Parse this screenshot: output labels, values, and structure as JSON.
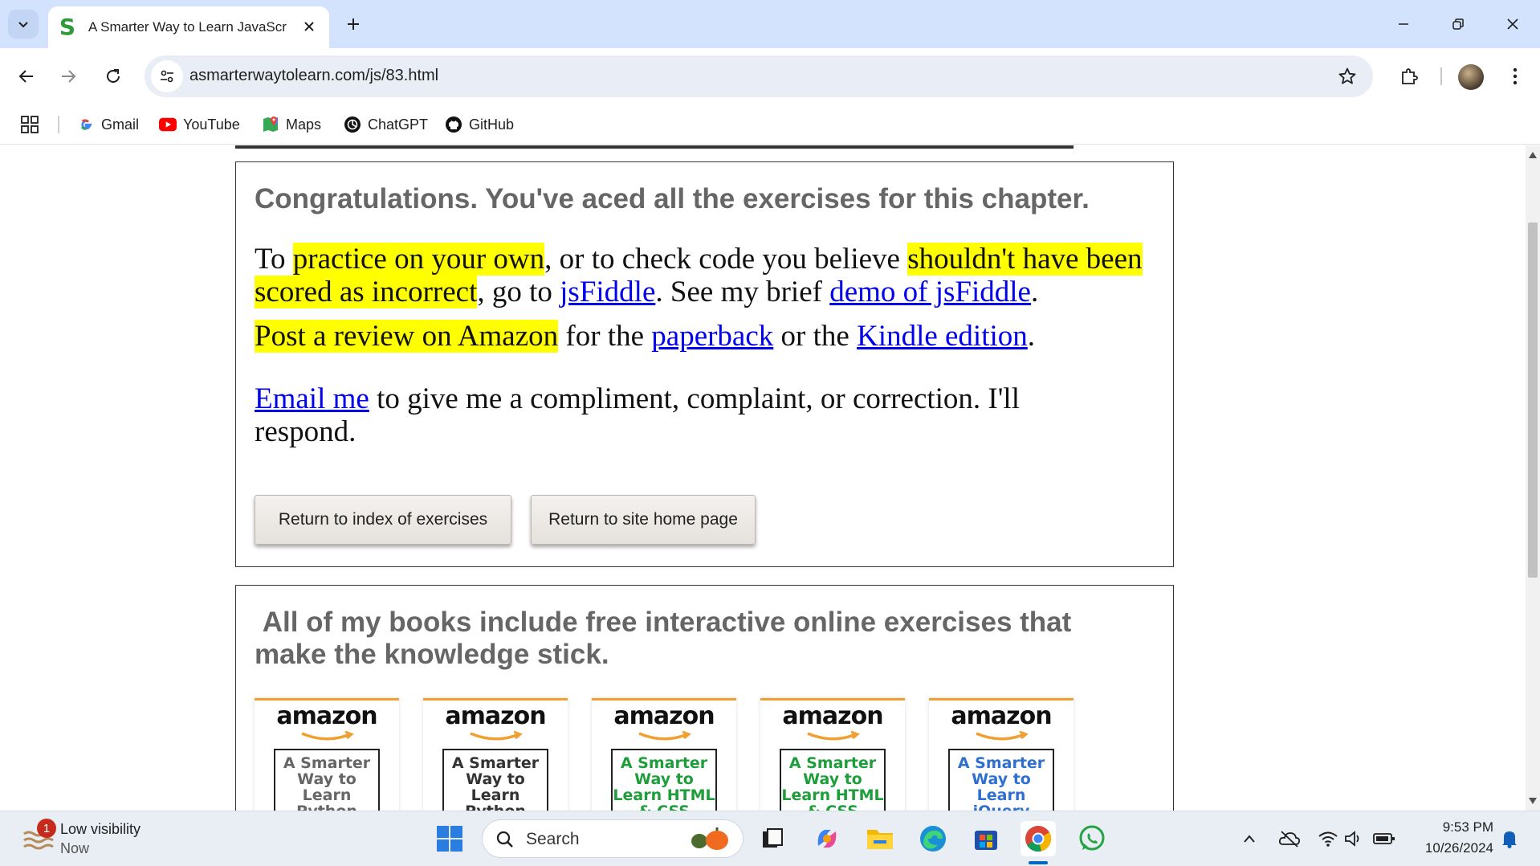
{
  "browser": {
    "tab_title": "A Smarter Way to Learn JavaScr",
    "url": "asmarterwaytolearn.com/js/83.html",
    "bookmarks": [
      {
        "label": "Gmail"
      },
      {
        "label": "YouTube"
      },
      {
        "label": "Maps"
      },
      {
        "label": "ChatGPT"
      },
      {
        "label": "GitHub"
      }
    ]
  },
  "page": {
    "congrats": "Congratulations. You've aced all the exercises for this chapter.",
    "p1": {
      "t1": "To ",
      "h1": "practice on your own",
      "t2": ", or to check code you believe ",
      "h2": "shouldn't have been scored as incorrect",
      "t3": ", go to ",
      "l1": "jsFiddle",
      "t4": ". See my brief ",
      "l2": "demo of jsFiddle",
      "t5": "."
    },
    "p2": {
      "h1": "Post a review on Amazon",
      "t1": " for the ",
      "l1": "paperback",
      "t2": " or the ",
      "l2": "Kindle edition",
      "t3": "."
    },
    "p3": {
      "l1": "Email me",
      "t1": " to give me a compliment, complaint, or correction. I'll respond."
    },
    "buttons": {
      "index": "Return to index of exercises",
      "home": "Return to site home page"
    },
    "books_heading": "All of my books include free interactive online exercises that make the knowledge stick.",
    "books": [
      {
        "brand": "amazon",
        "cover_text": "A Smarter Way to Learn Python",
        "color": "#666666"
      },
      {
        "brand": "amazon",
        "cover_text": "A Smarter Way to Learn Python",
        "color": "#333333"
      },
      {
        "brand": "amazon",
        "cover_text": "A Smarter Way to Learn HTML & CSS",
        "color": "#1e9e3a"
      },
      {
        "brand": "amazon",
        "cover_text": "A Smarter Way to Learn HTML & CSS",
        "color": "#1e9e3a"
      },
      {
        "brand": "amazon",
        "cover_text": "A Smarter Way to Learn jQuery",
        "color": "#2f6fd0"
      }
    ]
  },
  "taskbar": {
    "weather_badge": "1",
    "weather_title": "Low visibility",
    "weather_sub": "Now",
    "search_label": "Search",
    "time": "9:53 PM",
    "date": "10/26/2024"
  },
  "colors": {
    "highlight": "#ffff00",
    "link": "#0000ee",
    "heading_gray": "#666666",
    "amazon_orange": "#f0a030",
    "tab_strip": "#d3e3fd"
  }
}
